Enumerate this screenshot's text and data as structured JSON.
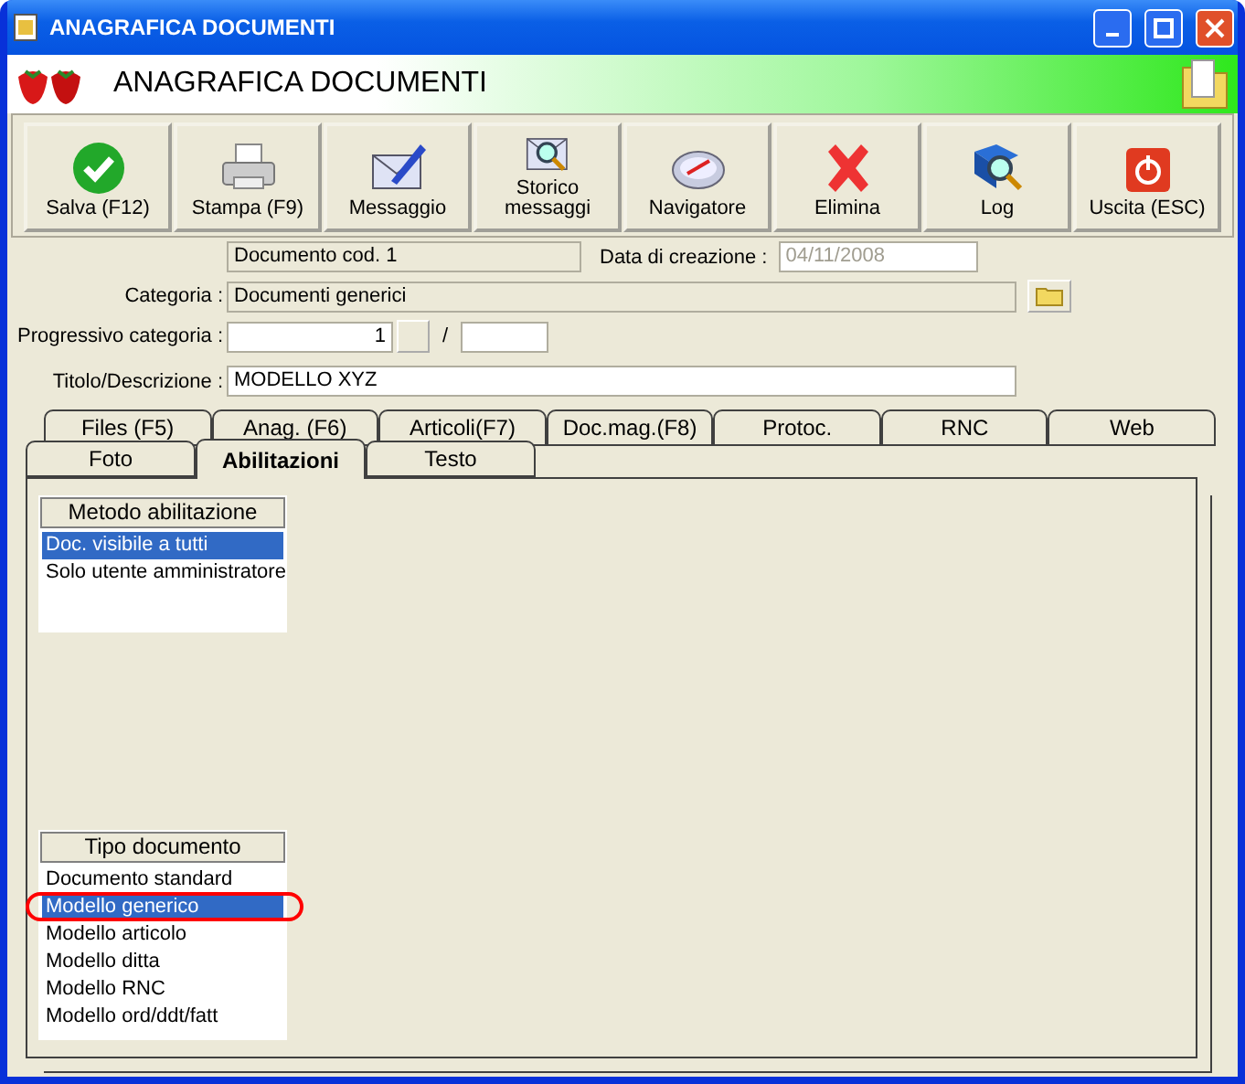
{
  "window": {
    "title": "ANAGRAFICA DOCUMENTI"
  },
  "header": {
    "title": "ANAGRAFICA DOCUMENTI"
  },
  "toolbar": [
    {
      "label": "Salva (F12)",
      "kind": "check"
    },
    {
      "label": "Stampa (F9)",
      "kind": "printer"
    },
    {
      "label": "Messaggio",
      "kind": "pen"
    },
    {
      "label": "Storico messaggi",
      "kind": "search"
    },
    {
      "label": "Navigatore",
      "kind": "compass"
    },
    {
      "label": "Elimina",
      "kind": "cross"
    },
    {
      "label": "Log",
      "kind": "book"
    },
    {
      "label": "Uscita (ESC)",
      "kind": "power"
    }
  ],
  "form": {
    "code": "Documento cod. 1",
    "date_label": "Data di creazione :",
    "date": "04/11/2008",
    "category_label": "Categoria :",
    "category": "Documenti generici",
    "progressive_label": "Progressivo categoria :",
    "progressive": "1",
    "separator": "/",
    "title_label": "Titolo/Descrizione :",
    "title": "MODELLO XYZ"
  },
  "tab_rows": [
    {
      "tabs": [
        {
          "label": "Files (F5)",
          "selected": false
        },
        {
          "label": "Anag. (F6)",
          "selected": false
        },
        {
          "label": "Articoli(F7)",
          "selected": false
        },
        {
          "label": "Doc.mag.(F8)",
          "selected": false
        },
        {
          "label": "Protoc.",
          "selected": false
        },
        {
          "label": "RNC",
          "selected": false
        },
        {
          "label": "Web",
          "selected": false
        }
      ]
    },
    {
      "tabs": [
        {
          "label": "Foto",
          "selected": false
        },
        {
          "label": "Abilitazioni",
          "selected": true
        },
        {
          "label": "Testo",
          "selected": false
        }
      ]
    }
  ],
  "lists": [
    {
      "header": "Metodo abilitazione",
      "items": [
        {
          "label": "Doc. visibile a tutti",
          "selected": true,
          "circled": false
        },
        {
          "label": "Solo utente amministratore",
          "selected": false,
          "circled": false
        }
      ]
    },
    {
      "header": "Tipo documento",
      "items": [
        {
          "label": "Documento standard",
          "selected": false,
          "circled": false
        },
        {
          "label": "Modello generico",
          "selected": true,
          "circled": true
        },
        {
          "label": "Modello articolo",
          "selected": false,
          "circled": false
        },
        {
          "label": "Modello ditta",
          "selected": false,
          "circled": false
        },
        {
          "label": "Modello RNC",
          "selected": false,
          "circled": false
        },
        {
          "label": "Modello ord/ddt/fatt",
          "selected": false,
          "circled": false
        }
      ]
    }
  ]
}
